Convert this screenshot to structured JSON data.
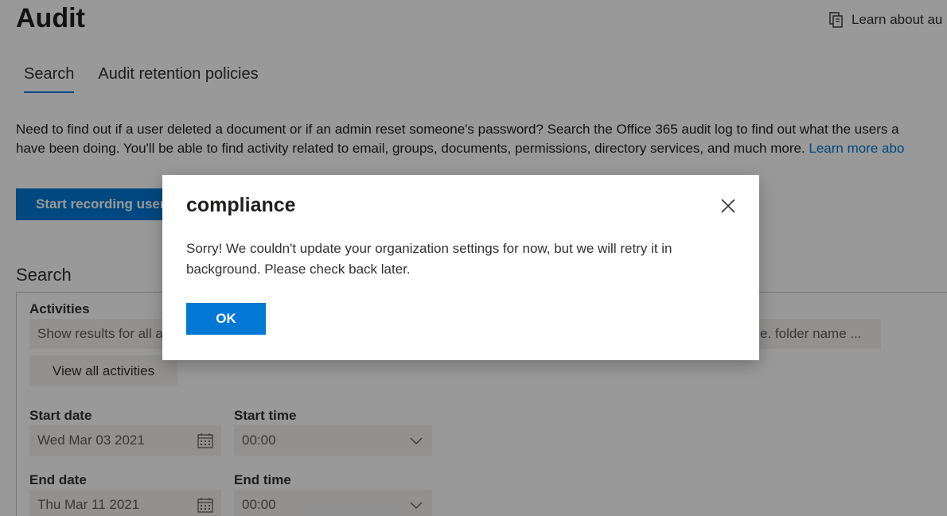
{
  "page": {
    "title": "Audit",
    "learn_about_link": "Learn about au"
  },
  "tabs": [
    {
      "label": "Search",
      "active": true
    },
    {
      "label": "Audit retention policies",
      "active": false
    }
  ],
  "intro": {
    "line1": "Need to find out if a user deleted a document or if an admin reset someone's password? Search the Office 365 audit log to find out what the users a",
    "line2": "have been doing. You'll be able to find activity related to email, groups, documents, permissions, directory services, and much more. ",
    "learn_more": "Learn more abo"
  },
  "start_recording_button": "Start recording user",
  "search": {
    "heading": "Search",
    "activities_label": "Activities",
    "activities_placeholder": "Show results for all a",
    "file_folder_placeholder": "e. folder name ...",
    "view_all_button": "View all activities",
    "start_date_label": "Start date",
    "start_date_value": "Wed Mar 03 2021",
    "start_time_label": "Start time",
    "start_time_value": "00:00",
    "end_date_label": "End date",
    "end_date_value": "Thu Mar 11 2021",
    "end_time_label": "End time",
    "end_time_value": "00:00"
  },
  "dialog": {
    "title": "compliance",
    "message": "Sorry! We couldn't update your organization settings for now, but we will retry it in background. Please check back later.",
    "ok_label": "OK"
  },
  "icons": {
    "learn_about": "document-copy-icon",
    "calendar": "calendar-icon",
    "chevron": "chevron-down-icon",
    "close": "close-icon"
  },
  "colors": {
    "accent": "#0078d4",
    "overlay": "rgba(0,0,0,0.4)"
  }
}
